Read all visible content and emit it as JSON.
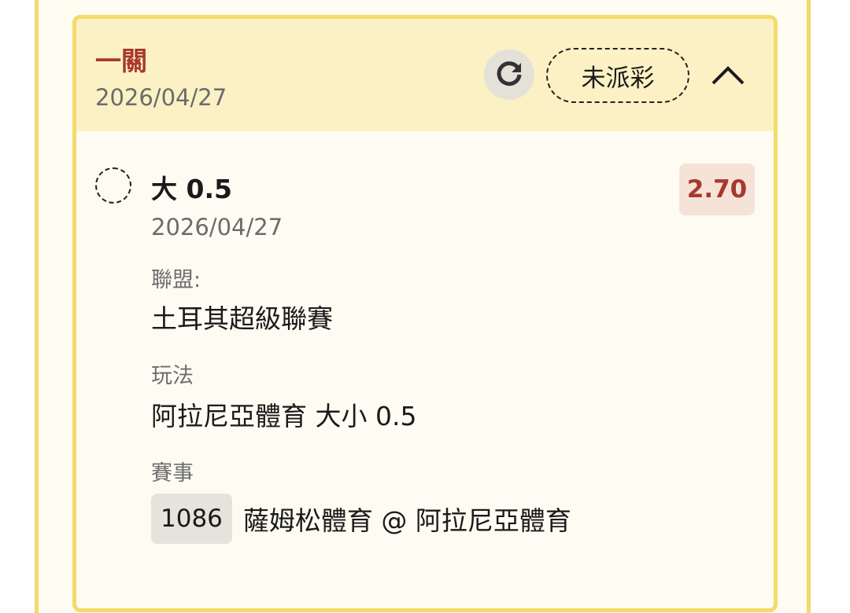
{
  "bet": {
    "type_label": "一關",
    "date": "2026/04/27",
    "status_label": "未派彩"
  },
  "selection": {
    "name": "大 0.5",
    "date": "2026/04/27",
    "odds": "2.70"
  },
  "fields": {
    "league_label": "聯盟:",
    "league_value": "土耳其超級聯賽",
    "market_label": "玩法",
    "market_value": "阿拉尼亞體育 大小 0.5",
    "event_label": "賽事",
    "event_id": "1086",
    "event_teams": "薩姆松體育 @ 阿拉尼亞體育"
  },
  "icons": {
    "refresh": "refresh-icon",
    "collapse": "chevron-up-icon",
    "selection_status": "pending-radio-icon"
  },
  "colors": {
    "accent_red": "#a8382e",
    "border_yellow": "#f3da6b",
    "header_bg": "#fcf1c4",
    "odds_bg": "#f5e3d8"
  }
}
